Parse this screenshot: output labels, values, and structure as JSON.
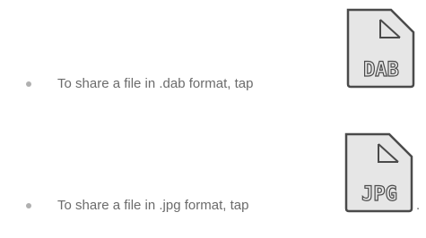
{
  "items": [
    {
      "text": "To share a file in .dab format, tap",
      "icon_name": "dab-file-icon",
      "icon_label": "DAB",
      "trailing": ""
    },
    {
      "text": "To share a file in .jpg format, tap",
      "icon_name": "jpg-file-icon",
      "icon_label": "JPG",
      "trailing": "."
    }
  ],
  "colors": {
    "text": "#6b6b6b",
    "bullet": "#b0b0b0",
    "icon_fill": "#e6e6e6",
    "icon_stroke": "#4a4a4a"
  }
}
